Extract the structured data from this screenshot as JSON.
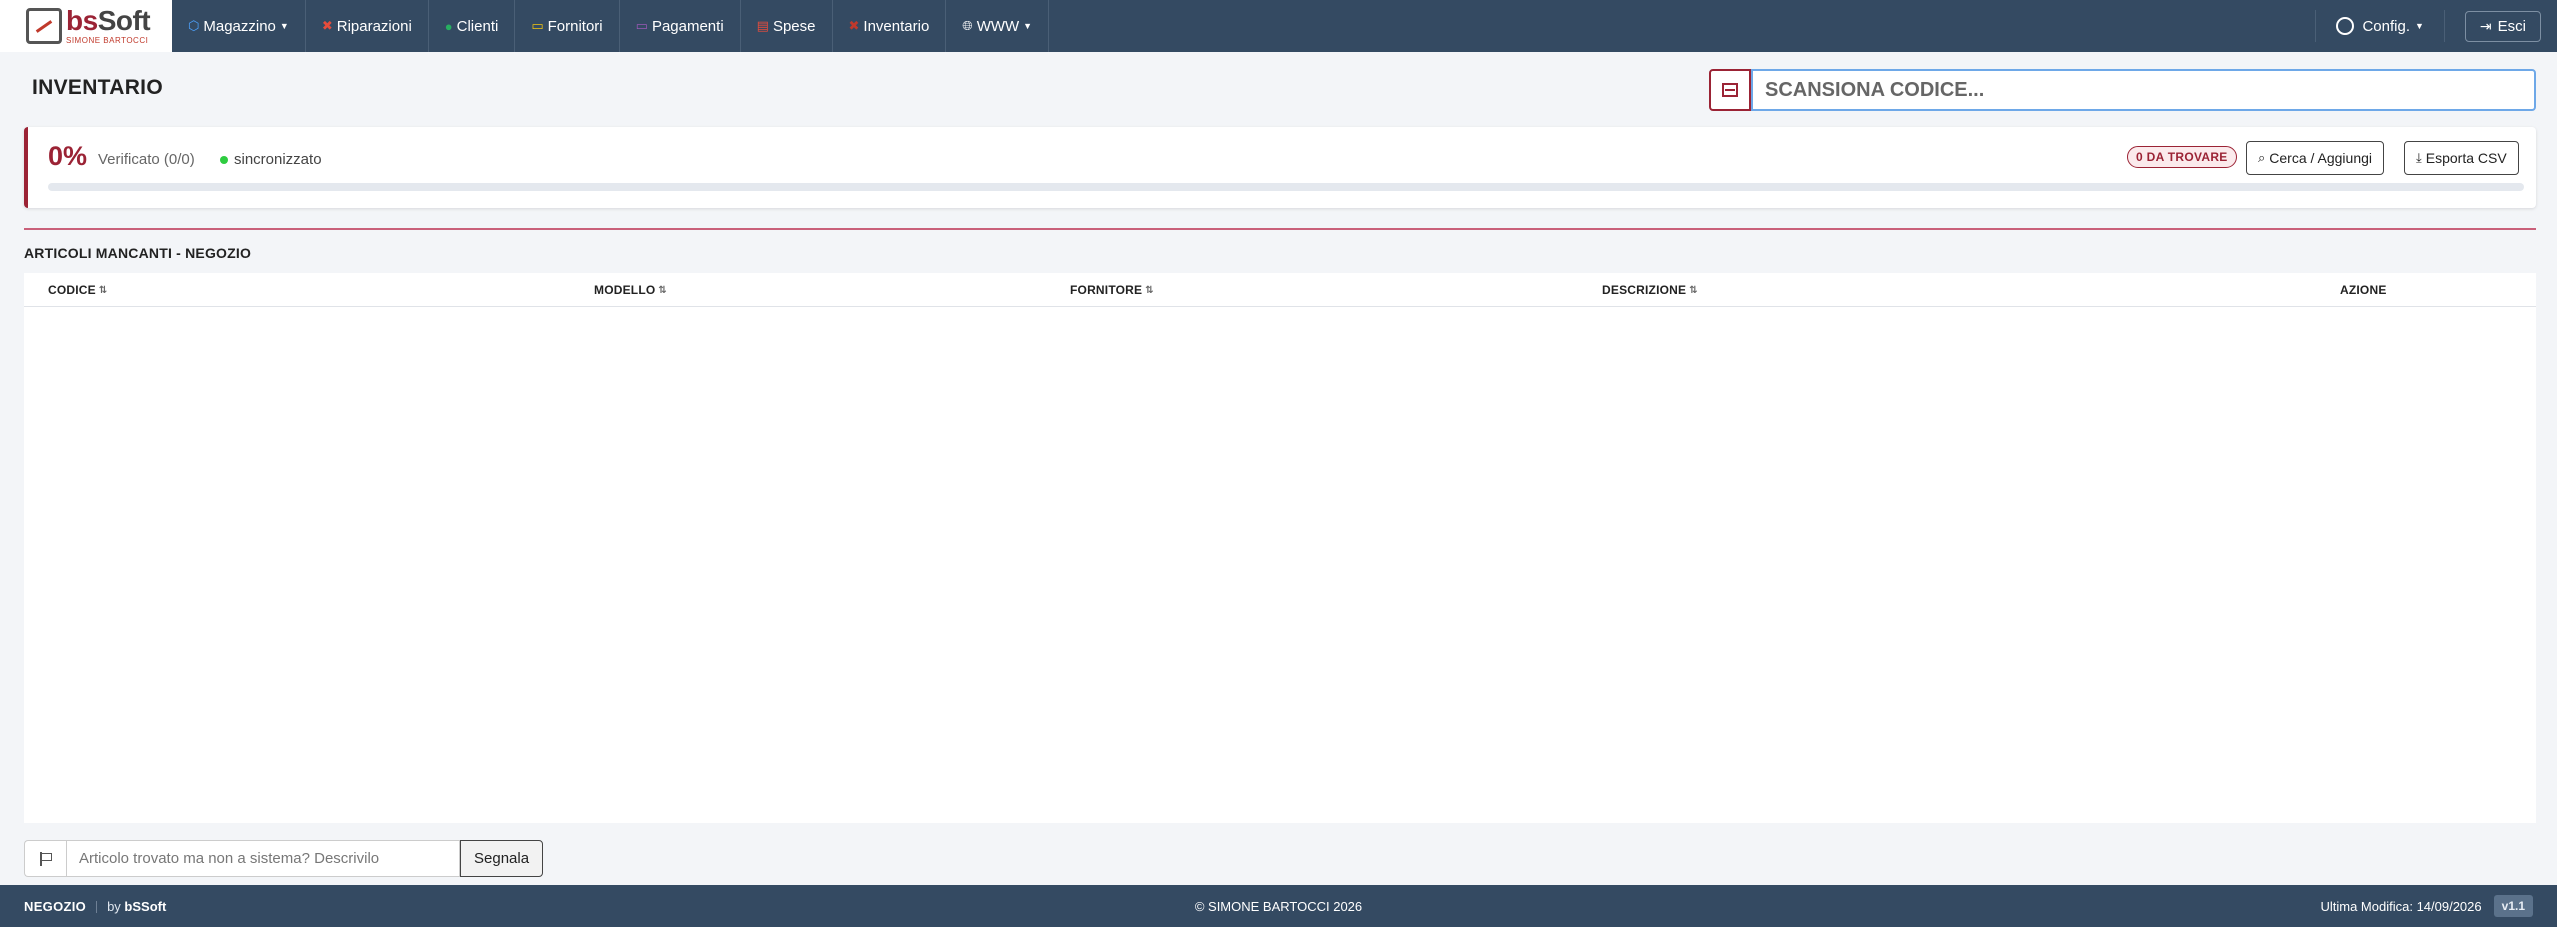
{
  "brand": {
    "name_accent": "bs",
    "name_rest": "Soft",
    "subtitle": "SIMONE BARTOCCI"
  },
  "nav": {
    "items": [
      {
        "label": "Magazzino",
        "icon": "box-icon",
        "color": "#4da3ff",
        "dropdown": true
      },
      {
        "label": "Riparazioni",
        "icon": "tools-icon",
        "color": "#e74c3c",
        "dropdown": false
      },
      {
        "label": "Clienti",
        "icon": "people-icon",
        "color": "#27ae60",
        "dropdown": false
      },
      {
        "label": "Fornitori",
        "icon": "truck-icon",
        "color": "#f1c40f",
        "dropdown": false
      },
      {
        "label": "Pagamenti",
        "icon": "wallet-icon",
        "color": "#9b59b6",
        "dropdown": false
      },
      {
        "label": "Spese",
        "icon": "receipt-icon",
        "color": "#e74c3c",
        "dropdown": false
      },
      {
        "label": "Inventario",
        "icon": "clipboard-icon",
        "color": "#c0392b",
        "dropdown": false
      },
      {
        "label": "WWW",
        "icon": "globe-icon",
        "color": "#ffffff",
        "dropdown": true
      }
    ],
    "config_label": "Config.",
    "logout_label": "Esci"
  },
  "page": {
    "title": "INVENTARIO"
  },
  "scan": {
    "placeholder": "SCANSIONA CODICE..."
  },
  "status": {
    "percent": "0%",
    "progress_fraction": 0,
    "verified": "Verificato (0/0)",
    "sync": "sincronizzato",
    "badge": "0 DA TROVARE",
    "search_label": "Cerca / Aggiungi",
    "export_label": "Esporta CSV"
  },
  "table": {
    "title": "ARTICOLI MANCANTI - NEGOZIO",
    "columns": {
      "code": "CODICE",
      "model": "MODELLO",
      "supplier": "FORNITORE",
      "description": "DESCRIZIONE",
      "action": "AZIONE"
    },
    "rows": []
  },
  "report": {
    "placeholder": "Articolo trovato ma non a sistema? Descrivilo",
    "button": "Segnala"
  },
  "footer": {
    "store": "NEGOZIO",
    "by_prefix": "by",
    "by_name": "bSSoft",
    "copyright": "© SIMONE BARTOCCI 2026",
    "last_modified": "Ultima Modifica: 14/09/2026",
    "version": "v1.1"
  },
  "colors": {
    "navbar": "#344a62",
    "accent": "#9b2335",
    "sync_ok": "#2ecc40"
  }
}
